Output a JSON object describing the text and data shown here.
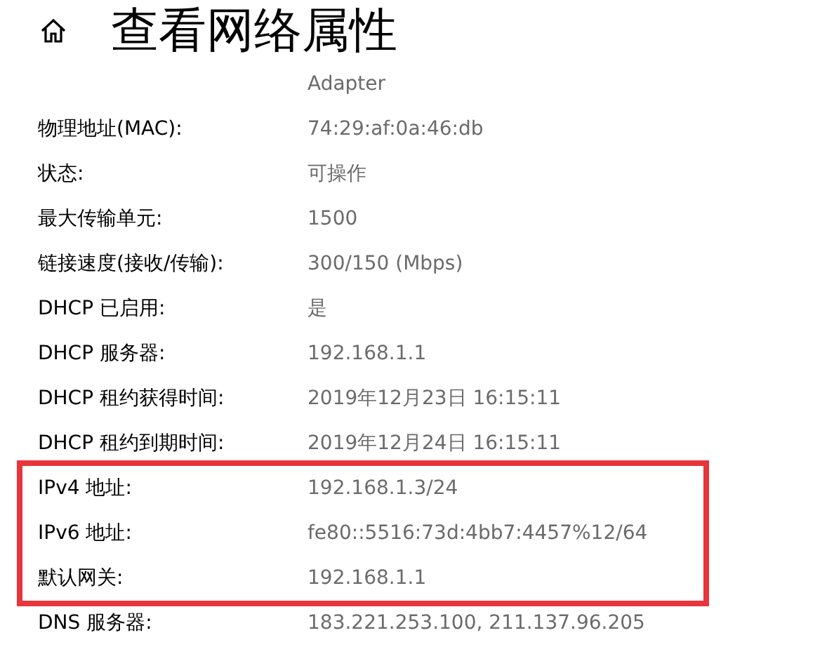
{
  "page": {
    "title": "查看网络属性"
  },
  "adapter": "Adapter",
  "sections": [
    {
      "highlighted": false,
      "rows": [
        {
          "label": "物理地址(MAC):",
          "value": "74:29:af:0a:46:db"
        },
        {
          "label": "状态:",
          "value": "可操作"
        },
        {
          "label": "最大传输单元:",
          "value": "1500"
        },
        {
          "label": "链接速度(接收/传输):",
          "value": "300/150 (Mbps)"
        },
        {
          "label": "DHCP 已启用:",
          "value": "是"
        },
        {
          "label": "DHCP 服务器:",
          "value": "192.168.1.1"
        },
        {
          "label": "DHCP 租约获得时间:",
          "value": "2019年12月23日 16:15:11"
        },
        {
          "label": "DHCP 租约到期时间:",
          "value": "2019年12月24日 16:15:11"
        }
      ]
    },
    {
      "highlighted": true,
      "rows": [
        {
          "label": "IPv4 地址:",
          "value": "192.168.1.3/24"
        },
        {
          "label": "IPv6 地址:",
          "value": "fe80::5516:73d:4bb7:4457%12/64"
        },
        {
          "label": "默认网关:",
          "value": "192.168.1.1"
        }
      ]
    },
    {
      "highlighted": false,
      "rows": [
        {
          "label": "DNS 服务器:",
          "value": "183.221.253.100, 211.137.96.205"
        }
      ]
    }
  ]
}
